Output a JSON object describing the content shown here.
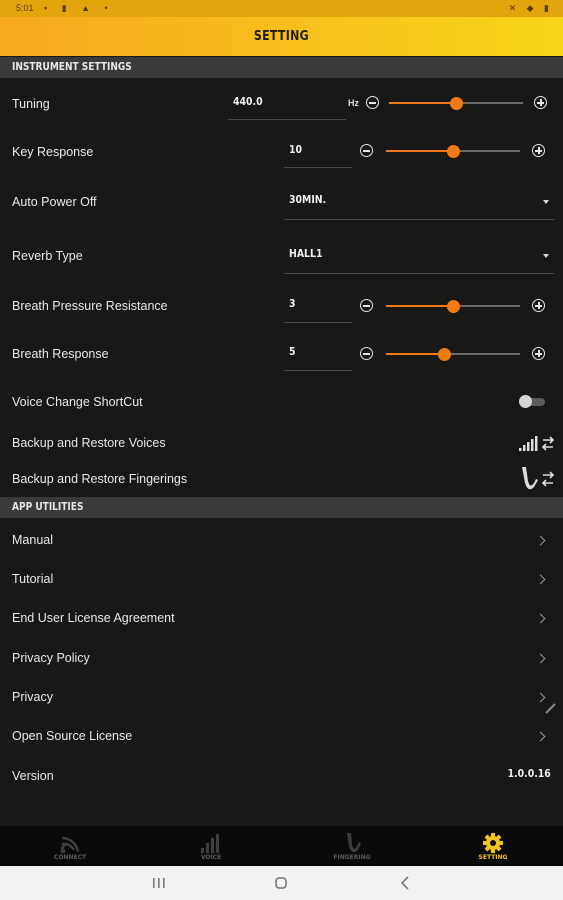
{
  "status_bar": {
    "time": "5:01"
  },
  "header": {
    "title": "SETTING"
  },
  "instrument_settings": {
    "title": "INSTRUMENT SETTINGS",
    "tuning": {
      "label": "Tuning",
      "value": "440.0",
      "unit": "Hz",
      "slider_level": 0.5
    },
    "key_response": {
      "label": "Key Response",
      "value": "10",
      "slider_level": 0.5
    },
    "auto_power_off": {
      "label": "Auto Power Off",
      "value": "30MIN."
    },
    "reverb_type": {
      "label": "Reverb Type",
      "value": "HALL1"
    },
    "breath_pressure_resistance": {
      "label": "Breath Pressure Resistance",
      "value": "3",
      "slider_level": 0.5
    },
    "breath_response": {
      "label": "Breath Response",
      "value": "5",
      "slider_level": 0.44
    },
    "voice_change_shortcut": {
      "label": "Voice Change ShortCut",
      "enabled": false
    },
    "backup_voices": {
      "label": "Backup and Restore Voices"
    },
    "backup_fingerings": {
      "label": "Backup and Restore Fingerings"
    }
  },
  "app_utilities": {
    "title": "APP UTILITIES",
    "items": [
      {
        "label": "Manual"
      },
      {
        "label": "Tutorial"
      },
      {
        "label": "End User License Agreement"
      },
      {
        "label": "Privacy Policy"
      },
      {
        "label": "Privacy"
      },
      {
        "label": "Open Source License"
      }
    ],
    "version": {
      "label": "Version",
      "value": "1.0.0.16"
    }
  },
  "tabs": [
    {
      "label": "CONNECT",
      "icon": "connect-icon",
      "active": false
    },
    {
      "label": "VOICE",
      "icon": "voice-icon",
      "active": false
    },
    {
      "label": "FINGERING",
      "icon": "saxophone-icon",
      "active": false
    },
    {
      "label": "SETTING",
      "icon": "gear-icon",
      "active": true
    }
  ],
  "colors": {
    "accent": "#f07a14",
    "header": "#f8c21c",
    "active_tab": "#f6c51c"
  }
}
